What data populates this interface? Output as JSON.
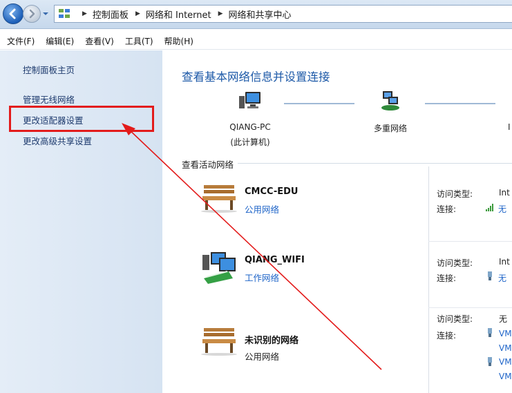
{
  "breadcrumb": {
    "items": [
      "控制面板",
      "网络和 Internet",
      "网络和共享中心"
    ]
  },
  "menu": {
    "items": [
      "文件(F)",
      "编辑(E)",
      "查看(V)",
      "工具(T)",
      "帮助(H)"
    ]
  },
  "sidebar": {
    "items": [
      {
        "label": "控制面板主页"
      },
      {
        "label": "管理无线网络"
      },
      {
        "label": "更改适配器设置"
      },
      {
        "label": "更改高级共享设置"
      }
    ]
  },
  "main": {
    "title": "查看基本网络信息并设置连接",
    "map": {
      "computer_name": "QIANG-PC",
      "computer_sub": "(此计算机)",
      "network_label": "多重网络",
      "internet_label": "I"
    },
    "active_title": "查看活动网络",
    "networks": [
      {
        "name": "CMCC-EDU",
        "type": "公用网络",
        "icon": "bench-icon",
        "access_label": "访问类型:",
        "access_value": "Int",
        "conn_label": "连接:",
        "conn_values": [
          "无"
        ]
      },
      {
        "name": "QIANG_WIFI",
        "type": "工作网络",
        "icon": "work-network-icon",
        "access_label": "访问类型:",
        "access_value": "Int",
        "conn_label": "连接:",
        "conn_values": [
          "无"
        ]
      },
      {
        "name": "未识别的网络",
        "type": "公用网络",
        "icon": "bench-icon",
        "access_label": "访问类型:",
        "access_value": "无",
        "conn_label": "连接:",
        "conn_values": [
          "VM",
          "VM",
          "VM",
          "VM"
        ]
      }
    ]
  },
  "colors": {
    "highlight": "#e31b1b",
    "link": "#1e64c8",
    "title": "#1e5aa8"
  }
}
